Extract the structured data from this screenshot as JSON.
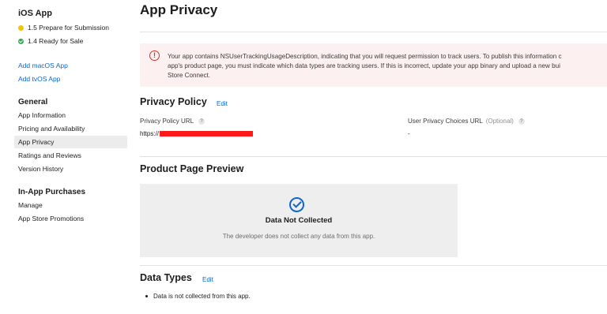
{
  "sidebar": {
    "app_title": "iOS App",
    "versions": [
      {
        "label": "1.5 Prepare for Submission",
        "status_color": "#f5c300"
      },
      {
        "label": "1.4 Ready for Sale",
        "status_color": "#34a853"
      }
    ],
    "add_links": [
      "Add macOS App",
      "Add tvOS App"
    ],
    "general_heading": "General",
    "general_items": [
      "App Information",
      "Pricing and Availability",
      "App Privacy",
      "Ratings and Reviews",
      "Version History"
    ],
    "active_item": "App Privacy",
    "iap_heading": "In-App Purchases",
    "iap_items": [
      "Manage",
      "App Store Promotions"
    ]
  },
  "main": {
    "title": "App Privacy",
    "alert": {
      "icon": "exclamation-circle-icon",
      "line1": "Your app contains NSUserTrackingUsageDescription, indicating that you will request permission to track users. To publish this information c",
      "line2": "app's product page, you must indicate which data types are tracking users. If this is incorrect, update your app binary and upload a new bui",
      "line3": "Store Connect."
    },
    "privacy_policy": {
      "heading": "Privacy Policy",
      "edit_label": "Edit",
      "url_label": "Privacy Policy URL",
      "url_value": "https://",
      "choices_label": "User Privacy Choices URL",
      "choices_optional": "(Optional)",
      "choices_value": "-",
      "help_glyph": "?"
    },
    "preview": {
      "heading": "Product Page Preview",
      "icon": "checkmark-circle-icon",
      "title": "Data Not Collected",
      "description": "The developer does not collect any data from this app."
    },
    "data_types": {
      "heading": "Data Types",
      "edit_label": "Edit",
      "bullet": "Data is not collected from this app."
    }
  },
  "colors": {
    "accent": "#0a68d0",
    "alert_bg": "#fdf0f0",
    "alert_icon": "#d32f2f",
    "redaction": "#ff1a1a"
  }
}
